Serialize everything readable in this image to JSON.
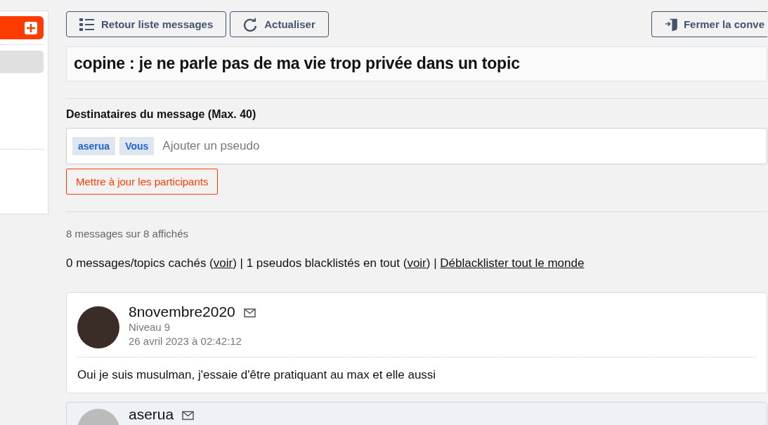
{
  "toolbar": {
    "buttons": [
      {
        "kind": "list",
        "label": "Retour liste messages"
      },
      {
        "kind": "refresh",
        "label": "Actualiser"
      }
    ],
    "close_button": {
      "label": "Fermer la conve"
    }
  },
  "title": "copine : je ne parle pas de ma vie trop privée dans un topic",
  "recipients": {
    "label": "Destinataires du message (Max. 40)",
    "tags": [
      "aserua",
      "Vous"
    ],
    "placeholder": "Ajouter un pseudo",
    "update_button": "Mettre à jour les participants"
  },
  "count": "8 messages sur 8 affichés",
  "hidden_info": [
    {
      "kind": "text",
      "text": "0 messages/topics cachés ("
    },
    {
      "kind": "link",
      "text": "voir"
    },
    {
      "kind": "text",
      "text": ") | 1 pseudos blacklistés en tout ("
    },
    {
      "kind": "link",
      "text": "voir"
    },
    {
      "kind": "text",
      "text": ") | "
    },
    {
      "kind": "link",
      "text": "Déblacklister tout le monde"
    }
  ],
  "messages": [
    {
      "author": "8novembre2020",
      "level": "Niveau 9",
      "date": "26 avril 2023 à 02:42:12",
      "body": "Oui je suis musulman, j'essaie d'être pratiquant au max et elle aussi",
      "own": false
    },
    {
      "author": "aserua",
      "own": true
    }
  ]
}
